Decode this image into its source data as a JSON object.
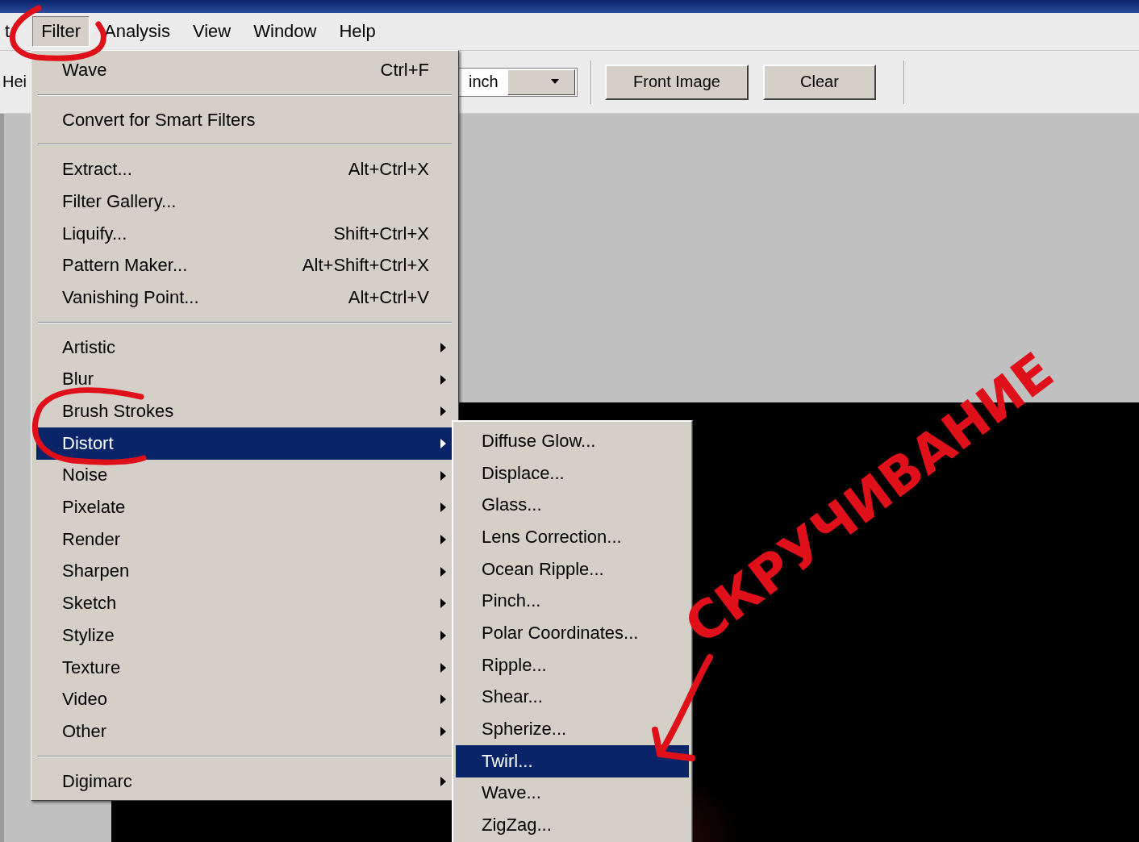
{
  "menu_bar": {
    "items": [
      {
        "label": "t",
        "selected": false
      },
      {
        "label": "Filter",
        "selected": true
      },
      {
        "label": "Analysis",
        "selected": false
      },
      {
        "label": "View",
        "selected": false
      },
      {
        "label": "Window",
        "selected": false
      },
      {
        "label": "Help",
        "selected": false
      }
    ]
  },
  "options_bar": {
    "label": "Hei",
    "dropdown": {
      "value": "inch"
    },
    "buttons": [
      "Front Image",
      "Clear"
    ]
  },
  "filter_menu": {
    "items": [
      {
        "kind": "item",
        "label": "Wave",
        "shortcut": "Ctrl+F",
        "has_submenu": false,
        "selected": false
      },
      {
        "kind": "separator"
      },
      {
        "kind": "item",
        "label": "Convert for Smart Filters",
        "has_submenu": false,
        "selected": false
      },
      {
        "kind": "separator"
      },
      {
        "kind": "item",
        "label": "Extract...",
        "shortcut": "Alt+Ctrl+X",
        "has_submenu": false,
        "selected": false
      },
      {
        "kind": "item",
        "label": "Filter Gallery...",
        "has_submenu": false,
        "selected": false
      },
      {
        "kind": "item",
        "label": "Liquify...",
        "shortcut": "Shift+Ctrl+X",
        "has_submenu": false,
        "selected": false
      },
      {
        "kind": "item",
        "label": "Pattern Maker...",
        "shortcut": "Alt+Shift+Ctrl+X",
        "has_submenu": false,
        "selected": false
      },
      {
        "kind": "item",
        "label": "Vanishing Point...",
        "shortcut": "Alt+Ctrl+V",
        "has_submenu": false,
        "selected": false
      },
      {
        "kind": "separator"
      },
      {
        "kind": "item",
        "label": "Artistic",
        "has_submenu": true,
        "selected": false
      },
      {
        "kind": "item",
        "label": "Blur",
        "has_submenu": true,
        "selected": false
      },
      {
        "kind": "item",
        "label": "Brush Strokes",
        "has_submenu": true,
        "selected": false
      },
      {
        "kind": "item",
        "label": "Distort",
        "has_submenu": true,
        "selected": true
      },
      {
        "kind": "item",
        "label": "Noise",
        "has_submenu": true,
        "selected": false
      },
      {
        "kind": "item",
        "label": "Pixelate",
        "has_submenu": true,
        "selected": false
      },
      {
        "kind": "item",
        "label": "Render",
        "has_submenu": true,
        "selected": false
      },
      {
        "kind": "item",
        "label": "Sharpen",
        "has_submenu": true,
        "selected": false
      },
      {
        "kind": "item",
        "label": "Sketch",
        "has_submenu": true,
        "selected": false
      },
      {
        "kind": "item",
        "label": "Stylize",
        "has_submenu": true,
        "selected": false
      },
      {
        "kind": "item",
        "label": "Texture",
        "has_submenu": true,
        "selected": false
      },
      {
        "kind": "item",
        "label": "Video",
        "has_submenu": true,
        "selected": false
      },
      {
        "kind": "item",
        "label": "Other",
        "has_submenu": true,
        "selected": false
      },
      {
        "kind": "separator"
      },
      {
        "kind": "item",
        "label": "Digimarc",
        "has_submenu": true,
        "selected": false
      }
    ]
  },
  "distort_submenu": {
    "items": [
      {
        "label": "Diffuse Glow...",
        "selected": false
      },
      {
        "label": "Displace...",
        "selected": false
      },
      {
        "label": "Glass...",
        "selected": false
      },
      {
        "label": "Lens Correction...",
        "selected": false
      },
      {
        "label": "Ocean Ripple...",
        "selected": false
      },
      {
        "label": "Pinch...",
        "selected": false
      },
      {
        "label": "Polar Coordinates...",
        "selected": false
      },
      {
        "label": "Ripple...",
        "selected": false
      },
      {
        "label": "Shear...",
        "selected": false
      },
      {
        "label": "Spherize...",
        "selected": false
      },
      {
        "label": "Twirl...",
        "selected": true
      },
      {
        "label": "Wave...",
        "selected": false
      },
      {
        "label": "ZigZag...",
        "selected": false
      }
    ]
  },
  "annotation": {
    "text": "СКРУЧИВАНИЕ"
  }
}
